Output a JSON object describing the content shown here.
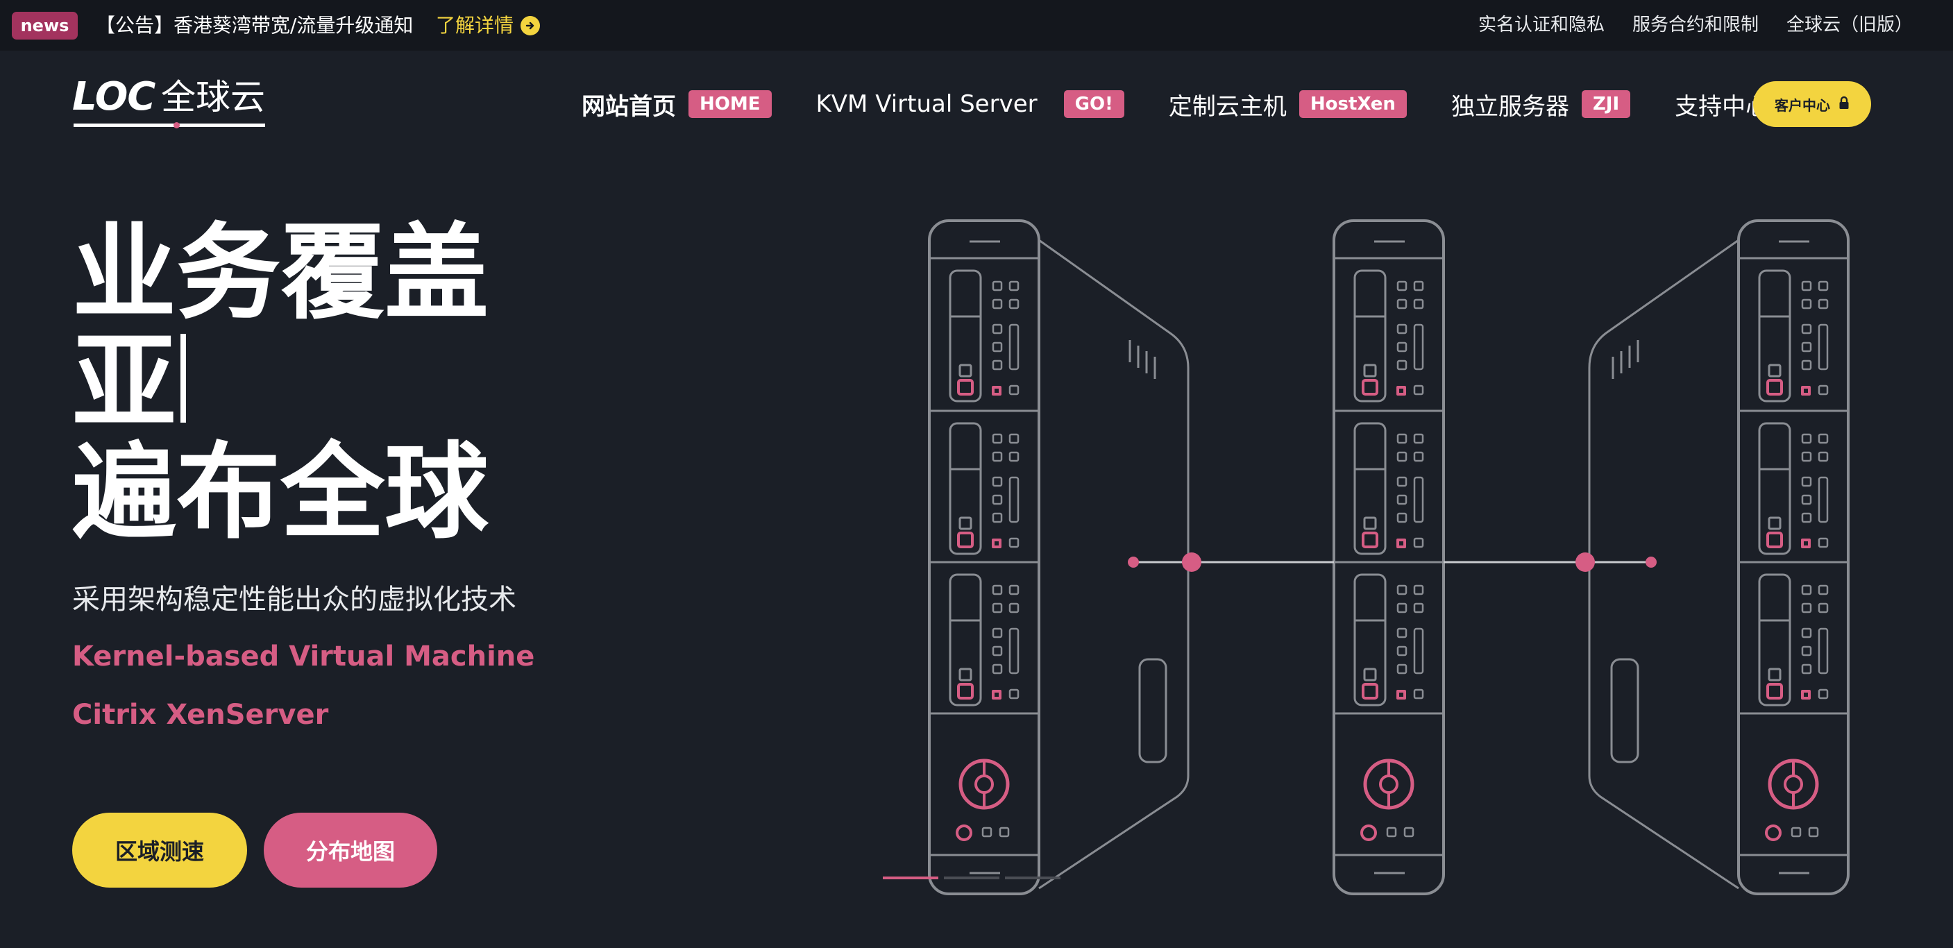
{
  "topbar": {
    "badge": "news",
    "notice": "【公告】香港葵湾带宽/流量升级通知",
    "notice_link": "了解详情",
    "links": [
      "实名认证和隐私",
      "服务合约和限制",
      "全球云（旧版）"
    ]
  },
  "logo": {
    "brand": "LOC",
    "cn": "全球云"
  },
  "nav": {
    "items": [
      {
        "label": "网站首页",
        "tag": "HOME",
        "active": true
      },
      {
        "label": "KVM Virtual Server",
        "tag": "GO!"
      },
      {
        "label": "定制云主机",
        "tag": "HostXen"
      },
      {
        "label": "独立服务器",
        "tag": "ZJI"
      },
      {
        "label": "支持中心",
        "tag": ""
      }
    ],
    "client_btn": "客户中心"
  },
  "hero": {
    "title_line1": "业务覆盖",
    "title_line2": "亚",
    "title_line3": "遍布全球",
    "subtitle": "采用架构稳定性能出众的虚拟化技术",
    "tech1": "Kernel-based Virtual Machine",
    "tech2": "Citrix XenServer",
    "btn_primary": "区域测速",
    "btn_secondary": "分布地图"
  },
  "colors": {
    "background": "#1b1f27",
    "topbar": "#14171d",
    "accent_pink": "#d65d84",
    "accent_yellow": "#f3d43f",
    "badge": "#a3335e",
    "line_gray": "#8a8d93"
  },
  "icons": {
    "notice_arrow": "arrow-right-circle-icon",
    "client_lock": "lock-icon"
  },
  "slider": {
    "active_index": 0,
    "count": 3
  }
}
